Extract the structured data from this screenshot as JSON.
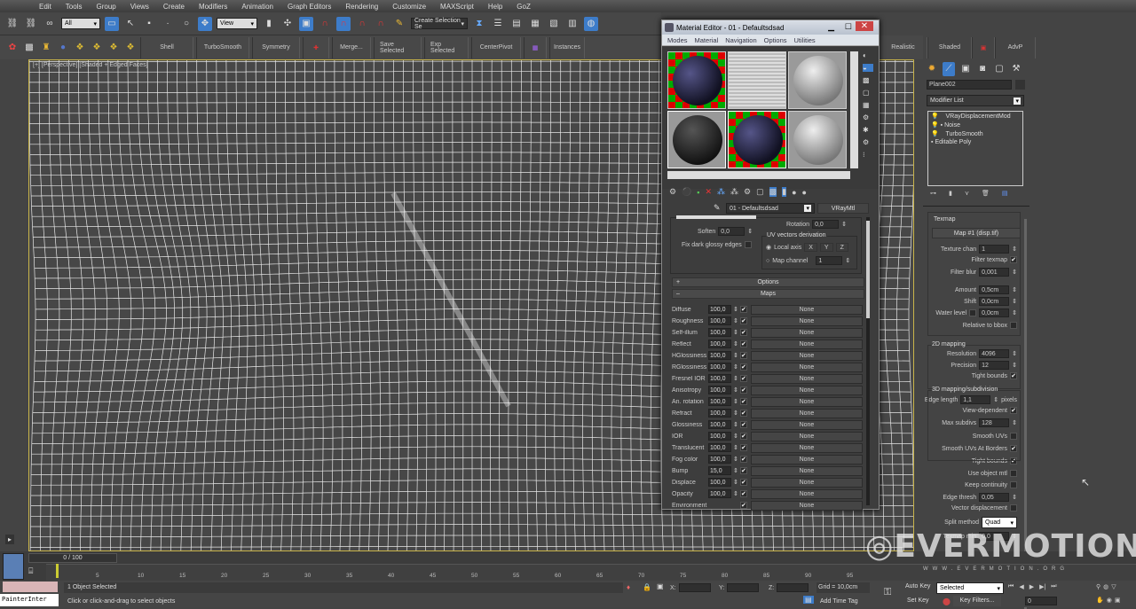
{
  "menu": [
    "Edit",
    "Tools",
    "Group",
    "Views",
    "Create",
    "Modifiers",
    "Animation",
    "Graph Editors",
    "Rendering",
    "Customize",
    "MAXScript",
    "Help",
    "GoZ"
  ],
  "toolbar1": {
    "selection_filter": "All",
    "ref_coord": "View",
    "named_selection": "Create Selection Se"
  },
  "toolbar2": {
    "buttons": [
      "Shell",
      "TurboSmooth",
      "Symmetry",
      "Merge...",
      "Save Selected",
      "Exp Selected",
      "CenterPivot",
      "Instances"
    ],
    "right_buttons": [
      "Realistic",
      "Shaded",
      "AdvP"
    ]
  },
  "viewport": {
    "label": "[+] [Perspective] [Shaded + Edged Faces]"
  },
  "material_editor": {
    "title": "Material Editor - 01 - Defaultsdsad",
    "menu": [
      "Modes",
      "Material",
      "Navigation",
      "Options",
      "Utilities"
    ],
    "material_name": "01 - Defaultsdsad",
    "material_type": "VRayMtl",
    "soften_label": "Soften",
    "soften": "0,0",
    "rotation_label": "Rotation",
    "rotation": "0,0",
    "fix_dark_label": "Fix dark glossy edges",
    "uv_group": "UV vectors derivation",
    "local_axis": "Local axis",
    "axes": [
      "X",
      "Y",
      "Z"
    ],
    "map_channel_label": "Map channel",
    "map_channel": "1",
    "options_rollout": "Options",
    "maps_rollout": "Maps",
    "maps": [
      {
        "name": "Diffuse",
        "amount": "100,0",
        "map": "None"
      },
      {
        "name": "Roughness",
        "amount": "100,0",
        "map": "None"
      },
      {
        "name": "Self-illum",
        "amount": "100,0",
        "map": "None"
      },
      {
        "name": "Reflect",
        "amount": "100,0",
        "map": "None"
      },
      {
        "name": "HGlossiness",
        "amount": "100,0",
        "map": "None"
      },
      {
        "name": "RGlossiness",
        "amount": "100,0",
        "map": "None"
      },
      {
        "name": "Fresnel IOR",
        "amount": "100,0",
        "map": "None"
      },
      {
        "name": "Anisotropy",
        "amount": "100,0",
        "map": "None"
      },
      {
        "name": "An. rotation",
        "amount": "100,0",
        "map": "None"
      },
      {
        "name": "Refract",
        "amount": "100,0",
        "map": "None"
      },
      {
        "name": "Glossiness",
        "amount": "100,0",
        "map": "None"
      },
      {
        "name": "IOR",
        "amount": "100,0",
        "map": "None"
      },
      {
        "name": "Translucent",
        "amount": "100,0",
        "map": "None"
      },
      {
        "name": "Fog color",
        "amount": "100,0",
        "map": "None"
      },
      {
        "name": "Bump",
        "amount": "15,0",
        "map": "None"
      },
      {
        "name": "Displace",
        "amount": "100,0",
        "map": "None"
      },
      {
        "name": "Opacity",
        "amount": "100,0",
        "map": "None"
      },
      {
        "name": "Environment",
        "amount": "",
        "map": "None"
      }
    ]
  },
  "command_panel": {
    "object_name": "Plane002",
    "modifier_list": "Modifier List",
    "stack": [
      "VRayDisplacementMod",
      "Noise",
      "TurboSmooth",
      "Editable Poly"
    ],
    "texmap_group": "Texmap",
    "texmap": "Map #1 (disp.tif)",
    "texture_chan_label": "Texture chan",
    "texture_chan": "1",
    "filter_texmap": "Filter texmap",
    "filter_blur_label": "Filter blur",
    "filter_blur": "0,001",
    "amount_label": "Amount",
    "amount": "0,5cm",
    "shift_label": "Shift",
    "shift": "0,0cm",
    "water_level_label": "Water level",
    "water_level": "0,0cm",
    "relative_bbox": "Relative to bbox",
    "mapping2d_group": "2D mapping",
    "resolution_label": "Resolution",
    "resolution": "4096",
    "precision_label": "Precision",
    "precision": "12",
    "tight_bounds": "Tight bounds",
    "mapping3d_group": "3D mapping/subdivision",
    "edge_length_label": "Edge length",
    "edge_length": "1,1",
    "pixels": "pixels",
    "view_dependent": "View-dependent",
    "max_subdivs_label": "Max subdivs",
    "max_subdivs": "128",
    "smooth_uvs": "Smooth UVs",
    "smooth_uvs_borders": "Smooth UVs At Borders",
    "tight_bounds2": "Tight bounds",
    "use_object_mtl": "Use object mtl",
    "keep_continuity": "Keep continuity",
    "edge_thresh_label": "Edge thresh",
    "edge_thresh": "0,05",
    "vector_disp": "Vector displacement",
    "split_method_label": "Split method",
    "split_method": "Quad",
    "texmap_min_label": "Texmap min",
    "texmap_min": "0,0"
  },
  "timeline": {
    "frame": "0 / 100",
    "ticks": [
      "5",
      "10",
      "15",
      "20",
      "25",
      "30",
      "35",
      "40",
      "45",
      "50",
      "55",
      "60",
      "65",
      "70",
      "75",
      "80",
      "85",
      "90",
      "95"
    ]
  },
  "status": {
    "script_listener": "PainterInter",
    "selected": "1 Object Selected",
    "prompt": "Click or click-and-drag to select objects",
    "x_label": "X:",
    "y_label": "Y:",
    "z_label": "Z:",
    "grid": "Grid = 10,0cm",
    "add_time_tag": "Add Time Tag",
    "auto_key": "Auto Key",
    "set_key": "Set Key",
    "key_mode": "Selected",
    "key_filters": "Key Filters...",
    "current_frame": "0"
  },
  "watermark": {
    "brand": "EVERMOTION",
    "url": "WWW.EVERMOTION.ORG"
  }
}
